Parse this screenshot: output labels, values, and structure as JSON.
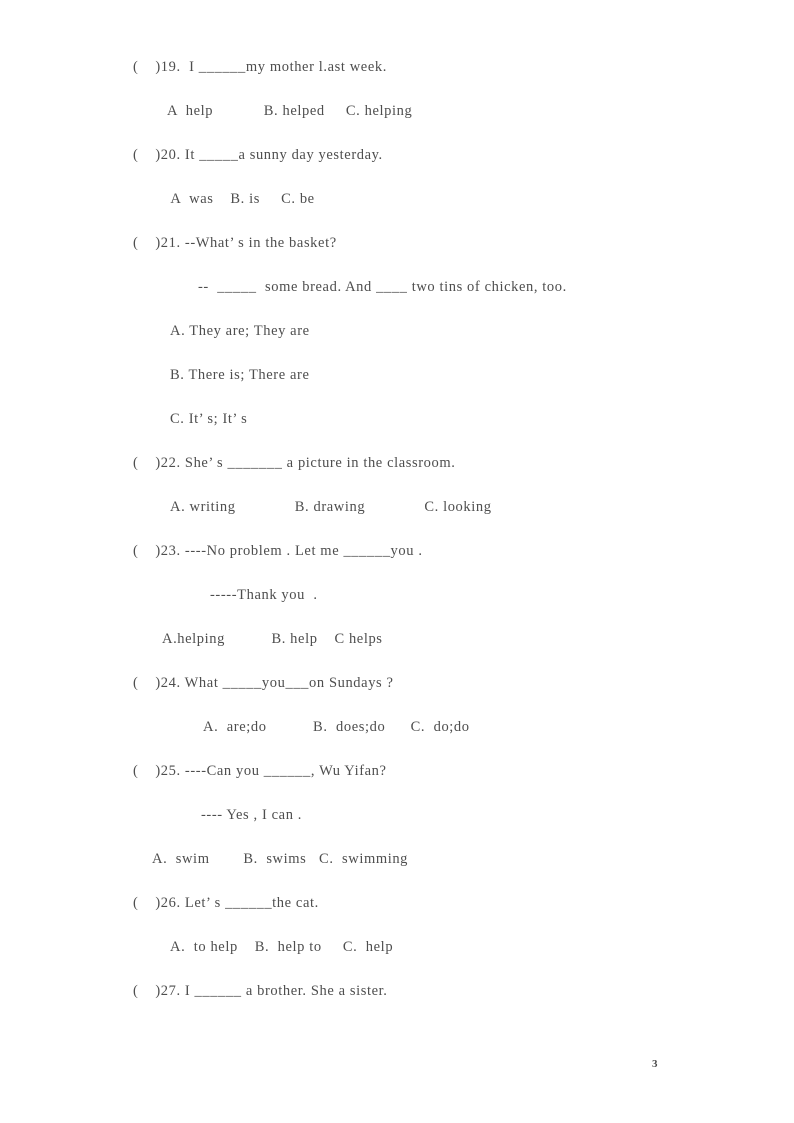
{
  "document": {
    "page_number": "3",
    "questions": [
      {
        "id": "q19",
        "stem": "(    )19.  I ______my mother l.ast week.",
        "options_line": "A  help            B. helped     C. helping"
      },
      {
        "id": "q20",
        "stem": "(    )20. It _____a sunny day yesterday.",
        "options_line": " A  was    B. is     C. be"
      },
      {
        "id": "q21",
        "stem": "(    )21. --What’ s in the basket?",
        "sub_lines": [
          "--  _____  some bread. And ____ two tins of chicken, too."
        ],
        "option_lines": [
          "A. They are; They are",
          "B. There is; There are",
          "C. It’ s; It’ s"
        ]
      },
      {
        "id": "q22",
        "stem": "(    )22. She’ s _______ a picture in the classroom.",
        "options_line": "A. writing              B. drawing              C. looking"
      },
      {
        "id": "q23",
        "stem": "(    )23. ----No problem . Let me ______you .",
        "sub_lines": [
          "-----Thank you  ."
        ],
        "options_line": "A.helping           B. help    C helps"
      },
      {
        "id": "q24",
        "stem": "(    )24. What _____you___on Sundays ?",
        "options_line": "A.  are;do           B.  does;do      C.  do;do"
      },
      {
        "id": "q25",
        "stem": "(    )25. ----Can you ______, Wu Yifan?",
        "sub_lines": [
          "---- Yes , I can ."
        ],
        "options_line": "A.  swim        B.  swims   C.  swimming"
      },
      {
        "id": "q26",
        "stem": "(    )26. Let’ s ______the cat.",
        "options_line": "A.  to help    B.  help to     C.  help"
      },
      {
        "id": "q27",
        "stem": "(    )27. I ______ a brother. She a sister.",
        "options_line": ""
      }
    ]
  }
}
